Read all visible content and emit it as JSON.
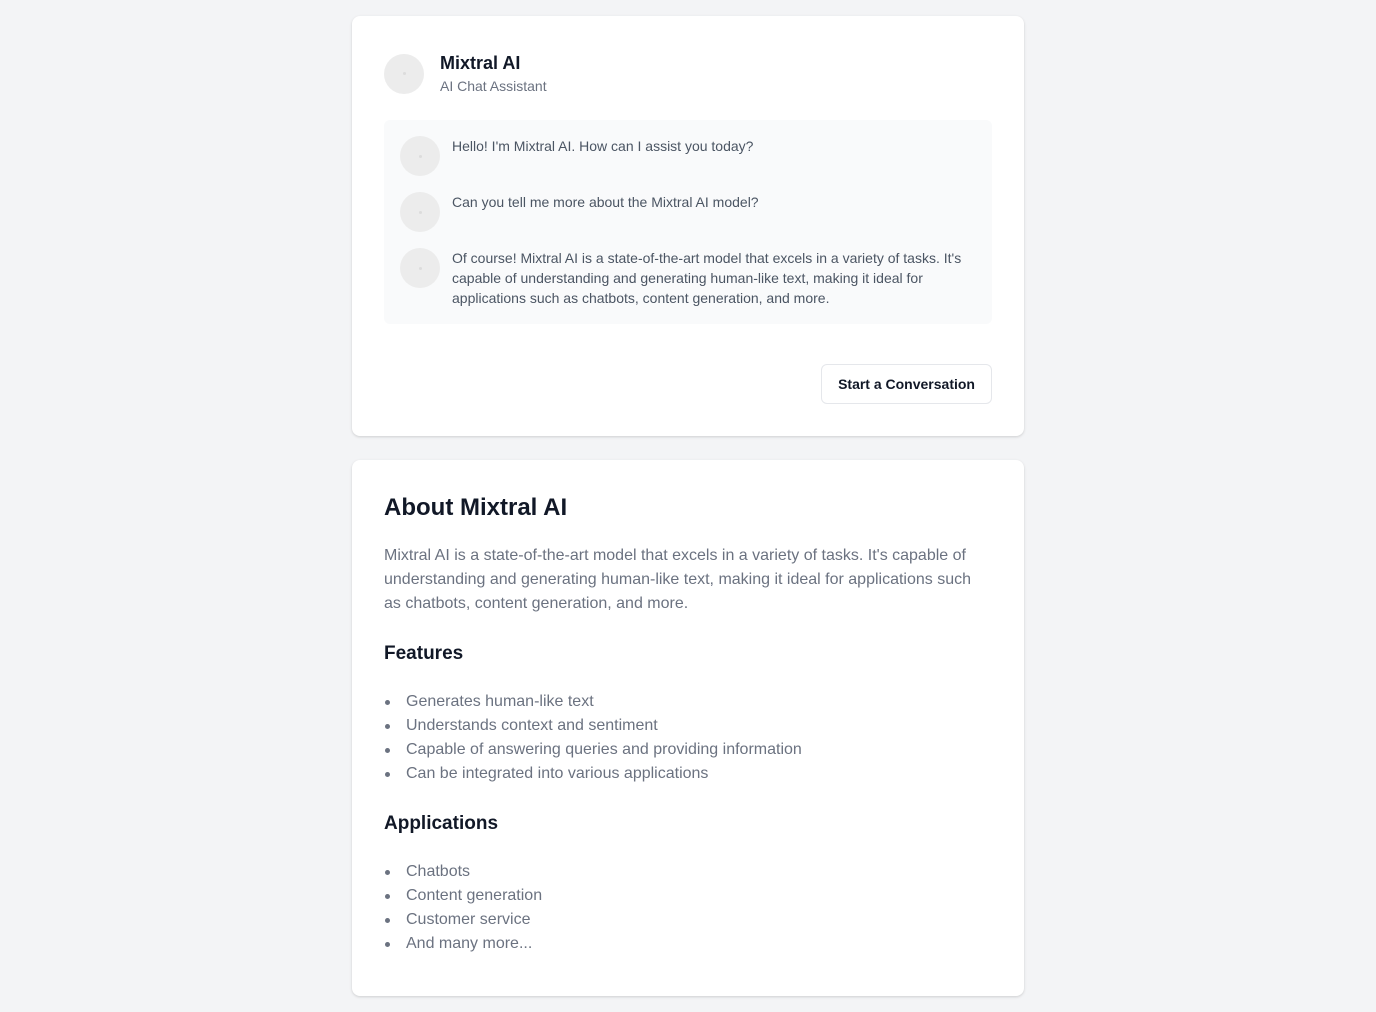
{
  "chat": {
    "name": "Mixtral AI",
    "subtitle": "AI Chat Assistant",
    "messages": [
      {
        "text": "Hello! I'm Mixtral AI. How can I assist you today?"
      },
      {
        "text": "Can you tell me more about the Mixtral AI model?"
      },
      {
        "text": "Of course! Mixtral AI is a state-of-the-art model that excels in a variety of tasks. It's capable of understanding and generating human-like text, making it ideal for applications such as chatbots, content generation, and more."
      }
    ],
    "start_button": "Start a Conversation"
  },
  "about": {
    "title": "About Mixtral AI",
    "description": "Mixtral AI is a state-of-the-art model that excels in a variety of tasks. It's capable of understanding and generating human-like text, making it ideal for applications such as chatbots, content generation, and more.",
    "features_title": "Features",
    "features": [
      "Generates human-like text",
      "Understands context and sentiment",
      "Capable of answering queries and providing information",
      "Can be integrated into various applications"
    ],
    "applications_title": "Applications",
    "applications": [
      "Chatbots",
      "Content generation",
      "Customer service",
      "And many more..."
    ]
  }
}
